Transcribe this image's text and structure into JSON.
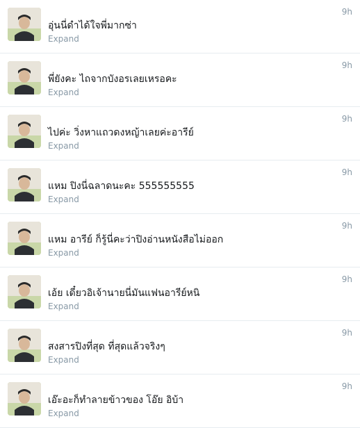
{
  "tweets": [
    {
      "text": "อุ่นนี่ดำได้ใจพี่มากซ่า",
      "time": "9h",
      "expand": "Expand"
    },
    {
      "text": "พี่ยังคะ ไถจากบังอรเลยเหรอคะ",
      "time": "9h",
      "expand": "Expand"
    },
    {
      "text": "ไปค่ะ วิ่งหาแถวดงหญ้าเลยค่ะอารีย์",
      "time": "9h",
      "expand": "Expand"
    },
    {
      "text": "แหม ปิงนี่ฉลาดนะคะ 555555555",
      "time": "9h",
      "expand": "Expand"
    },
    {
      "text": "แหม อารีย์ ก็รู้นี่คะว่าปิงอ่านหนังสือไม่ออก",
      "time": "9h",
      "expand": "Expand"
    },
    {
      "text": "เอ้ย เดี๋ยวอิเจ้านายนี่มันแฟนอารีย์หนิ",
      "time": "9h",
      "expand": "Expand"
    },
    {
      "text": "สงสารปิงที่สุด ที่สุดแล้วจริงๆ",
      "time": "9h",
      "expand": "Expand"
    },
    {
      "text": "เอ๊ะอะก็ทำลายข้าวของ โอ๊ย อิบ้า",
      "time": "9h",
      "expand": "Expand"
    }
  ],
  "icons": {
    "avatar": "user-avatar-photo"
  },
  "colors": {
    "meta_text": "#8899a6",
    "body_text": "#14171a",
    "divider": "#e6ecf0",
    "avatar_bg": "#c9d7a8"
  }
}
